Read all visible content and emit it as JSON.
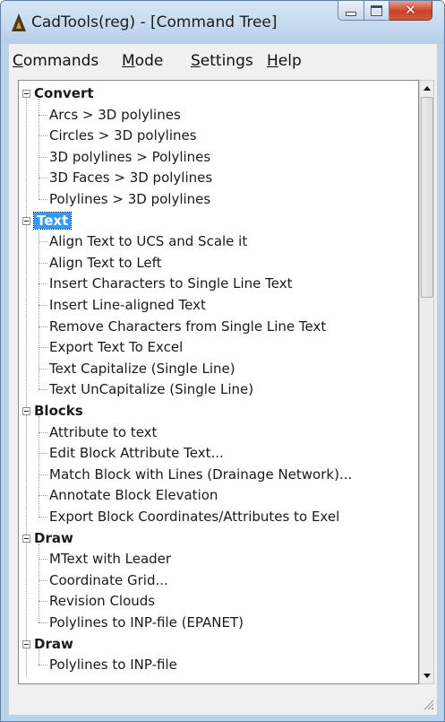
{
  "window": {
    "title": "CadTools(reg) - [Command Tree]"
  },
  "menu": [
    {
      "hot": "C",
      "rest": "ommands"
    },
    {
      "hot": "M",
      "rest": "ode"
    },
    {
      "hot": "S",
      "rest": "ettings"
    },
    {
      "hot": "H",
      "rest": "elp"
    }
  ],
  "tree": [
    {
      "label": "Convert",
      "selected": false,
      "items": [
        "Arcs > 3D polylines",
        "Circles > 3D polylines",
        "3D polylines > Polylines",
        "3D Faces > 3D polylines",
        "Polylines > 3D polylines"
      ]
    },
    {
      "label": "Text",
      "selected": true,
      "items": [
        "Align Text to UCS and Scale it",
        "Align Text to Left",
        "Insert Characters to Single Line Text",
        "Insert Line-aligned Text",
        "Remove Characters from Single Line Text",
        "Export Text To Excel",
        "Text Capitalize (Single Line)",
        "Text UnCapitalize (Single Line)"
      ]
    },
    {
      "label": "Blocks",
      "selected": false,
      "items": [
        "Attribute to text",
        "Edit Block Attribute Text...",
        "Match Block with Lines (Drainage Network)...",
        "Annotate Block Elevation",
        "Export Block Coordinates/Attributes to Exel"
      ]
    },
    {
      "label": "Draw",
      "selected": false,
      "items": [
        "MText with Leader",
        "Coordinate Grid...",
        "Revision Clouds",
        "Polylines to INP-file (EPANET)"
      ]
    },
    {
      "label": "Draw",
      "selected": false,
      "items": [
        "Polylines to INP-file"
      ]
    }
  ]
}
